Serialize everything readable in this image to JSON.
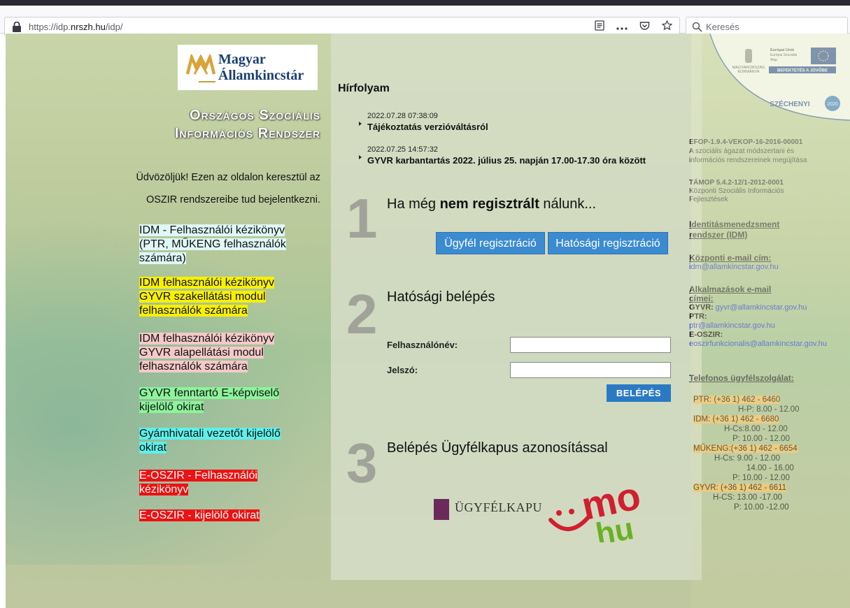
{
  "browser": {
    "url_prefix": "https://idp.",
    "url_domain": "nrszh.hu",
    "url_suffix": "/idp/",
    "search_placeholder": "Keresés"
  },
  "logo": {
    "line1": "Magyar",
    "line2": "Államkincstár"
  },
  "system_title": {
    "line1": "Országos Szociális",
    "line2": "Információs Rendszer"
  },
  "welcome": {
    "line1": "Üdvözöljük! Ezen az oldalon keresztül az",
    "line2": "OSZIR rendszereibe tud bejelentkezni."
  },
  "doc_links": [
    {
      "text": "IDM - Felhasználói kézikönyv (PTR, MŰKENG felhasználók számára)",
      "bg": "#dff7f7",
      "color": "#111"
    },
    {
      "text": "IDM felhasználói kézikönyv GYVR szakellátási modul felhasználók számára",
      "bg": "#f8f000",
      "color": "#111"
    },
    {
      "text": "IDM felhasználói kézikönyv GYVR alapellátási modul felhasználók számára",
      "bg": "#f5c9c9",
      "color": "#111"
    },
    {
      "text": "GYVR fenntartó E-képviselő kijelölő okirat",
      "bg": "#8cf49a",
      "color": "#111"
    },
    {
      "text": "Gyámhivatali vezetőt kijelölő okirat",
      "bg": "#5ef0ea",
      "color": "#111"
    },
    {
      "text": "E-OSZIR - Felhasználói kézikönyv",
      "bg": "#ee1111",
      "color": "#fff"
    },
    {
      "text": "E-OSZIR - kijelölő okirat",
      "bg": "#ee1111",
      "color": "#fff"
    }
  ],
  "news": {
    "title": "Hírfolyam",
    "items": [
      {
        "date": "2022.07.28 07:38:09",
        "text": "Tájékoztatás verzióváltásról"
      },
      {
        "date": "2022.07.25 14:57:32",
        "text": "GYVR karbantartás 2022. július 25. napján 17.00-17.30 óra között"
      }
    ]
  },
  "step1": {
    "num": "1",
    "title_pre": "Ha még ",
    "title_bold": "nem regisztrált",
    "title_post": " nálunk...",
    "btn_client": "Ügyfél regisztráció",
    "btn_authority": "Hatósági regisztráció"
  },
  "step2": {
    "num": "2",
    "title": "Hatósági belépés",
    "username_label": "Felhasználónév:",
    "password_label": "Jelszó:",
    "login_button": "BELÉPÉS"
  },
  "step3": {
    "num": "3",
    "title": "Belépés Ügyfélkapus azonosítással",
    "ugyfelkapu_text": "ÜGYFÉLKAPU",
    "mo_text": "mo",
    "hu_text": "hu"
  },
  "eu_panel": {
    "gov_line1": "MAGYARORSZÁG",
    "gov_line2": "KORMÁNYA",
    "eu_line1": "Európai Unió",
    "eu_line2": "Európai Szociális",
    "eu_line3": "Alap",
    "invest": "BEFEKTETÉS A JÖVŐBE",
    "szechenyi": "SZÉCHENYI",
    "year": "2020"
  },
  "right": {
    "efop_code": "EFOP-1.9.4-VEKOP-16-2016-00001",
    "efop_desc": "A szociális ágazat módszertani és információs rendszereinek megújítása",
    "tamop_code": "TÁMOP 5.4.2-12/1-2012-0001",
    "tamop_desc": "Központi Szociális Információs Fejlesztések",
    "idm_head": "Identitásmenedzsment rendszer (IDM)",
    "central_email_head": "Központi e-mail cím:",
    "central_email": "idm@allamkincstar.gov.hu",
    "app_email_head": "Alkalmazások e-mail címei:",
    "gyvr_label": "GYVR:",
    "gyvr_email": "gyvr@allamkincstar.gov.hu",
    "ptr_label": "PTR:",
    "ptr_email": "ptr@allamkincstar.gov.hu",
    "eoszir_label": "E-OSZIR:",
    "eoszir_email": "eoszirfunkcionalis@allamkincstar.gov.hu",
    "phone_head": "Telefonos ügyfélszolgálat:",
    "phone_lines": [
      {
        "text": "PTR:   (+36 1) 462 - 6460",
        "highlight": true
      },
      {
        "text": "H-P: 8.00 - 12.00",
        "highlight": false
      },
      {
        "text": "IDM:    (+36 1) 462 - 6680",
        "highlight": true
      },
      {
        "text": "H-Cs:8.00 - 12.00",
        "highlight": false
      },
      {
        "text": "P: 10.00 - 12.00",
        "highlight": false
      },
      {
        "text": "MŰKENG:(+36 1) 462 - 6654",
        "highlight": true
      },
      {
        "text": "H-Cs: 9.00 - 12.00",
        "highlight": false
      },
      {
        "text": "14.00 - 16.00",
        "highlight": false
      },
      {
        "text": "P: 10.00 - 12.00",
        "highlight": false
      },
      {
        "text": "GYVR:   (+36 1) 462 - 6611",
        "highlight": true
      },
      {
        "text": "H-CS: 13.00 -17.00",
        "highlight": false
      },
      {
        "text": "P: 10.00 -12.00",
        "highlight": false
      }
    ]
  }
}
